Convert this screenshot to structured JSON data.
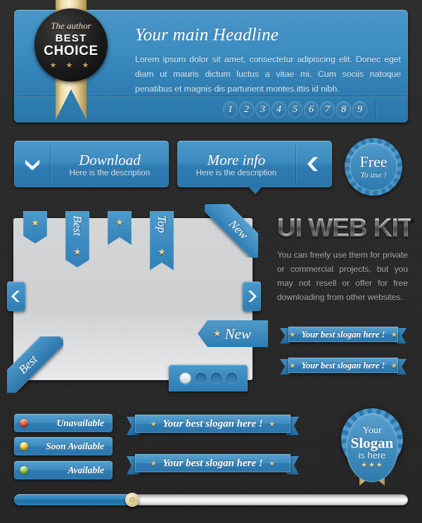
{
  "hero": {
    "badge": {
      "author_label": "The author",
      "best_label": "BEST",
      "choice_label": "CHOICE",
      "stars": "★ ★ ★"
    },
    "title": "Your main Headline",
    "body": "Lorem ipsum dolor sit amet, consectetur adipiscing elit. Donec eget diam ut mauris dictum luctus a vitae mi. Cum sociis natoque penatibus et magnis dis parturient montes.ittis id nibh.",
    "pagination": [
      "1",
      "2",
      "3",
      "4",
      "5",
      "6",
      "7",
      "8",
      "9"
    ]
  },
  "buttons": {
    "download": {
      "title": "Download",
      "subtitle": "Here is the description"
    },
    "more_info": {
      "title": "More info",
      "subtitle": "Here is the description"
    },
    "free_badge": {
      "line1": "Free",
      "line2": "To use !"
    }
  },
  "panel": {
    "ribbons": [
      {
        "label": "",
        "star": "★",
        "shape": "point",
        "size": "short"
      },
      {
        "label": "Best",
        "star": "★",
        "shape": "point",
        "size": "tall"
      },
      {
        "label": "",
        "star": "★",
        "shape": "notch",
        "size": "short"
      },
      {
        "label": "Top",
        "star": "★",
        "shape": "notch",
        "size": "tall"
      }
    ],
    "corner_new": "New",
    "corner_best": "Best",
    "new_flag": {
      "star": "★",
      "label": "New"
    },
    "prev_arrow": "chevron-left",
    "next_arrow": "chevron-right",
    "dots": {
      "count": 4,
      "active_index": 0
    }
  },
  "kit": {
    "title": "UI WEB KIT",
    "description": "You can freely use them for private or commercial projects, but you may not resell or offer for free downloading from other websites."
  },
  "slogan_ribbons": [
    {
      "star_left": "★",
      "text": "Your best slogan here !",
      "star_right": "★"
    },
    {
      "star_left": "★",
      "text": "Your best slogan here !",
      "star_right": "★"
    },
    {
      "star_left": "★",
      "text": "Your best slogan here !",
      "star_right": "★"
    },
    {
      "star_left": "★",
      "text": "Your best slogan here !",
      "star_right": "★"
    }
  ],
  "status_buttons": [
    {
      "label": "Unavailable",
      "color": "#e04a32"
    },
    {
      "label": "Soon Available",
      "color": "#e8c327"
    },
    {
      "label": "Available",
      "color": "#84c236"
    }
  ],
  "slogan_badge": {
    "line1": "Your",
    "line2": "Slogan",
    "line3": "is here",
    "stars": "★★★"
  },
  "slider": {
    "value": 30,
    "min": 0,
    "max": 100
  },
  "colors": {
    "blue_light": "#4e9bcc",
    "blue_dark": "#2a76ac",
    "gold": "#e3d199",
    "panel_gray": "#d4d5d7",
    "background": "#2b2b2b"
  }
}
